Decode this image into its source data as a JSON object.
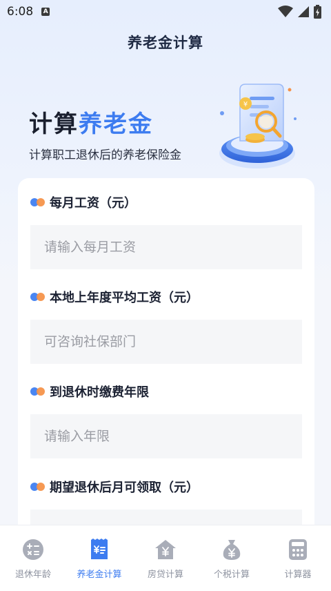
{
  "status_bar": {
    "time": "6:08",
    "notification_icon": "A"
  },
  "nav": {
    "title": "养老金计算"
  },
  "hero": {
    "title_part1": "计算",
    "title_part2": "养老金",
    "subtitle": "计算职工退休后的养老保险金"
  },
  "form": {
    "fields": [
      {
        "label": "每月工资（元）",
        "placeholder": "请输入每月工资",
        "value": ""
      },
      {
        "label": "本地上年度平均工资（元）",
        "placeholder": "可咨询社保部门",
        "value": ""
      },
      {
        "label": "到退休时缴费年限",
        "placeholder": "请输入年限",
        "value": ""
      },
      {
        "label": "期望退休后月可领取（元）",
        "placeholder": "",
        "value": ""
      }
    ]
  },
  "tabs": [
    {
      "label": "退休年龄",
      "icon": "calculator-circle-icon",
      "active": false
    },
    {
      "label": "养老金计算",
      "icon": "receipt-icon",
      "active": true
    },
    {
      "label": "房贷计算",
      "icon": "house-yen-icon",
      "active": false
    },
    {
      "label": "个税计算",
      "icon": "money-bag-icon",
      "active": false
    },
    {
      "label": "计算器",
      "icon": "calculator-icon",
      "active": false
    }
  ],
  "colors": {
    "accent": "#3d7cf0",
    "inactive_tab": "#8e93a0",
    "dot_blue": "#4a86f2",
    "dot_orange": "#f5934a",
    "input_bg": "#f5f6f8"
  }
}
